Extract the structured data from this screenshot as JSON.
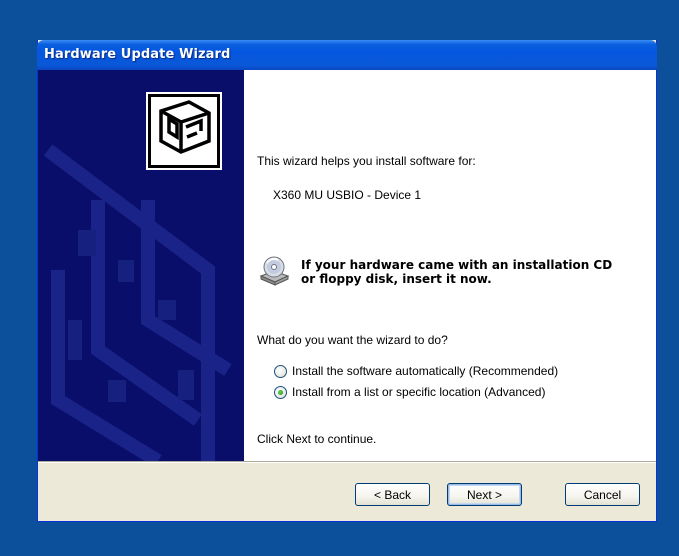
{
  "window": {
    "title": "Hardware Update Wizard"
  },
  "content": {
    "intro": "This wizard helps you install software for:",
    "device_name": "X360 MU USBIO - Device 1",
    "cd_message_line1": "If your hardware came with an installation CD",
    "cd_message_line2": "or floppy disk, insert it now.",
    "question": "What do you want the wizard to do?",
    "options": [
      {
        "label": "Install the software automatically (Recommended)",
        "selected": false
      },
      {
        "label": "Install from a list or specific location (Advanced)",
        "selected": true
      }
    ],
    "continue_hint": "Click Next to continue."
  },
  "buttons": {
    "back": "< Back",
    "next": "Next >",
    "cancel": "Cancel"
  },
  "icons": {
    "wizard": "hardware-wizard-icon",
    "cd": "cd-drive-icon"
  },
  "colors": {
    "desktop": "#0c4f9a",
    "sidebar": "#0a0e6b",
    "titlebar": "#0556e0",
    "dialog": "#ece9d8"
  }
}
